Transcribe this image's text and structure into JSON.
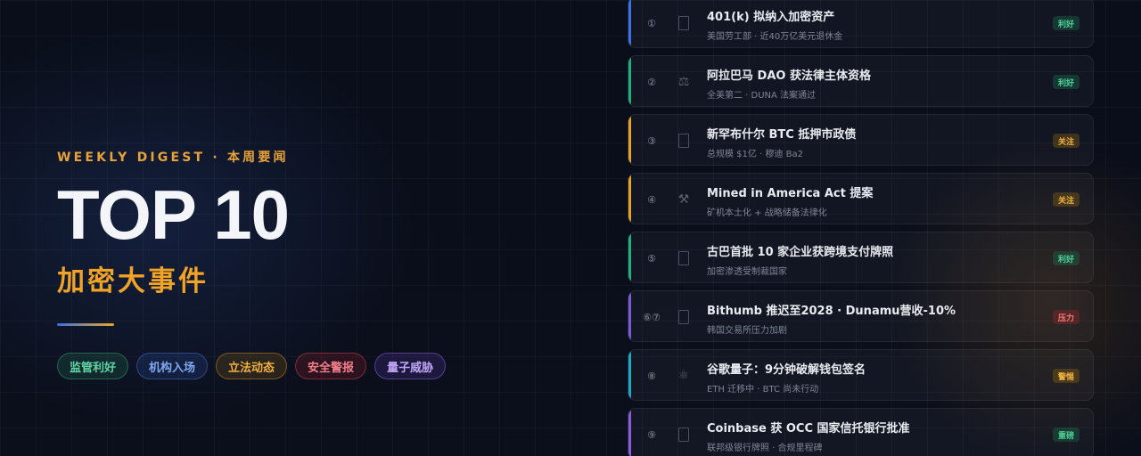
{
  "header": {
    "kicker": "WEEKLY DIGEST · 本周要闻",
    "title": "TOP 10",
    "subtitle": "加密大事件"
  },
  "tags": [
    {
      "label": "监管利好",
      "color": "#5fd6a4"
    },
    {
      "label": "机构入场",
      "color": "#7fa8f0"
    },
    {
      "label": "立法动态",
      "color": "#f0b040"
    },
    {
      "label": "安全警报",
      "color": "#f07f8a"
    },
    {
      "label": "量子威胁",
      "color": "#c0a4f5"
    }
  ],
  "items": [
    {
      "num": "①",
      "icon": "document-icon",
      "title": "401(k) 拟纳入加密资产",
      "sub": "美国劳工部 · 近40万亿美元退休金",
      "badge": "利好",
      "accent": "#3b72e6"
    },
    {
      "num": "②",
      "icon": "scales-icon",
      "title": "阿拉巴马 DAO 获法律主体资格",
      "sub": "全美第二 · DUNA 法案通过",
      "badge": "利好",
      "accent": "#22b07c"
    },
    {
      "num": "③",
      "icon": "document-icon",
      "title": "新罕布什尔 BTC 抵押市政债",
      "sub": "总规模 $1亿 · 穆迪 Ba2",
      "badge": "关注",
      "accent": "#e8a326"
    },
    {
      "num": "④",
      "icon": "pickaxe-icon",
      "title": "Mined in America Act 提案",
      "sub": "矿机本土化 + 战略储备法律化",
      "badge": "关注",
      "accent": "#e8a326"
    },
    {
      "num": "⑤",
      "icon": "document-icon",
      "title": "古巴首批 10 家企业获跨境支付牌照",
      "sub": "加密渗透受制裁国家",
      "badge": "利好",
      "accent": "#22b07c"
    },
    {
      "num": "⑥⑦",
      "icon": "document-icon",
      "title": "Bithumb 推迟至2028 · Dunamu营收-10%",
      "sub": "韩国交易所压力加剧",
      "badge": "压力",
      "accent": "#7a5be0"
    },
    {
      "num": "⑧",
      "icon": "atom-icon",
      "title": "谷歌量子：9分钟破解钱包签名",
      "sub": "ETH 迁移中 · BTC 尚未行动",
      "badge": "警惕",
      "accent": "#20a8c8"
    },
    {
      "num": "⑨",
      "icon": "document-icon",
      "title": "Coinbase 获 OCC 国家信托银行批准",
      "sub": "联邦级银行牌照 · 合规里程碑",
      "badge": "重磅",
      "accent": "#8a5ce6"
    }
  ]
}
